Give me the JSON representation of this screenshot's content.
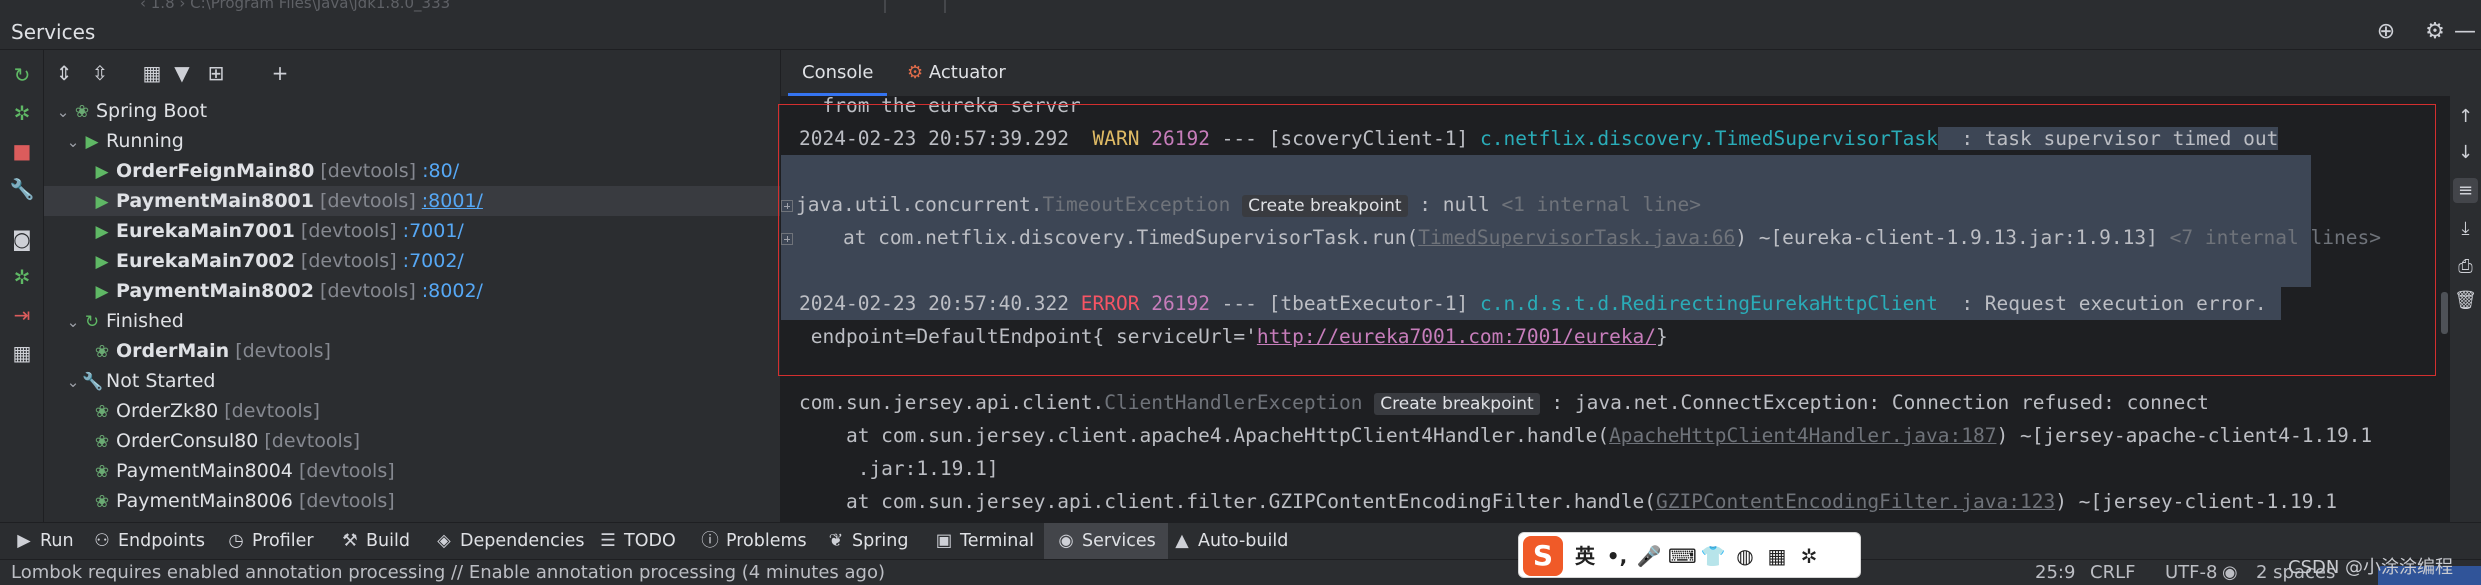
{
  "top_strip": {
    "path_text": "‹ 1.8 ›   C:\\Program Files\\Java\\jdk1.8.0_333"
  },
  "window": {
    "title": "Services"
  },
  "tree": {
    "spring_boot_label": "Spring Boot",
    "running_label": "Running",
    "running_items": [
      {
        "name": "OrderFeignMain80",
        "tag": "[devtools]",
        "port": ":80/"
      },
      {
        "name": "PaymentMain8001",
        "tag": "[devtools]",
        "port": ":8001/"
      },
      {
        "name": "EurekaMain7001",
        "tag": "[devtools]",
        "port": ":7001/"
      },
      {
        "name": "EurekaMain7002",
        "tag": "[devtools]",
        "port": ":7002/"
      },
      {
        "name": "PaymentMain8002",
        "tag": "[devtools]",
        "port": ":8002/"
      }
    ],
    "finished_label": "Finished",
    "finished_items": [
      {
        "name": "OrderMain",
        "tag": "[devtools]"
      }
    ],
    "not_started_label": "Not Started",
    "not_started_items": [
      {
        "name": "OrderZk80",
        "tag": "[devtools]"
      },
      {
        "name": "OrderConsul80",
        "tag": "[devtools]"
      },
      {
        "name": "PaymentMain8004",
        "tag": "[devtools]"
      },
      {
        "name": "PaymentMain8006",
        "tag": "[devtools]"
      }
    ]
  },
  "console_tabs": {
    "console": "Console",
    "actuator": "Actuator"
  },
  "console": {
    "l0": "  from the eureka server",
    "l1_time": "2024-02-23 20:57:39.292",
    "l1_level": "WARN",
    "l1_pid": "26192",
    "l1_thread": " --- [scoveryClient-1] ",
    "l1_class": "c.netflix.discovery.TimedSupervisorTask",
    "l1_msg": "  : task supervisor timed out",
    "l3_pre": "java.util.concurrent.",
    "l3_exc": "TimeoutException",
    "l3_bp": "Create breakpoint",
    "l3_post": " : null ",
    "l3_internal": "<1 internal line>",
    "l4_pre": "    at com.netflix.discovery.TimedSupervisorTask.run(",
    "l4_link": "TimedSupervisorTask.java:66",
    "l4_post": ") ~[eureka-client-1.9.13.jar:1.9.13] ",
    "l4_internal": "<7 internal lines>",
    "l6_time": "2024-02-23 20:57:40.322",
    "l6_level": "ERROR",
    "l6_pid": "26192",
    "l6_thread": " --- [tbeatExecutor-1] ",
    "l6_class": "c.n.d.s.t.d.RedirectingEurekaHttpClient",
    "l6_msg": "  : Request execution error.",
    "l7_pre": " endpoint=DefaultEndpoint{ serviceUrl='",
    "l7_url": "http://eureka7001.com:7001/eureka/",
    "l7_post": "}",
    "l9_pre": "com.sun.jersey.api.client.",
    "l9_exc": "ClientHandlerException",
    "l9_bp": "Create breakpoint",
    "l9_post": " : java.net.ConnectException: Connection refused: connect",
    "l10_pre": "    at com.sun.jersey.client.apache4.ApacheHttpClient4Handler.handle(",
    "l10_link": "ApacheHttpClient4Handler.java:187",
    "l10_post": ") ~[jersey-apache-client4-1.19.1",
    "l11": "     .jar:1.19.1]",
    "l12_pre": "    at com.sun.jersey.api.client.filter.GZIPContentEncodingFilter.handle(",
    "l12_link": "GZIPContentEncodingFilter.java:123",
    "l12_post": ") ~[jersey-client-1.19.1"
  },
  "bottom_tabs": {
    "run": "Run",
    "endpoints": "Endpoints",
    "profiler": "Profiler",
    "build": "Build",
    "dependencies": "Dependencies",
    "todo": "TODO",
    "problems": "Problems",
    "spring": "Spring",
    "terminal": "Terminal",
    "services": "Services",
    "autobuild": "Auto-build"
  },
  "status": {
    "message": "Lombok requires enabled annotation processing // Enable annotation processing (4 minutes ago)",
    "position": "25:9",
    "line_sep": "CRLF",
    "encoding": "UTF-8",
    "indent": "2 spaces"
  },
  "ime": {
    "logo": "S",
    "lang": "英"
  },
  "watermark": "CSDN @小涂涂编程"
}
